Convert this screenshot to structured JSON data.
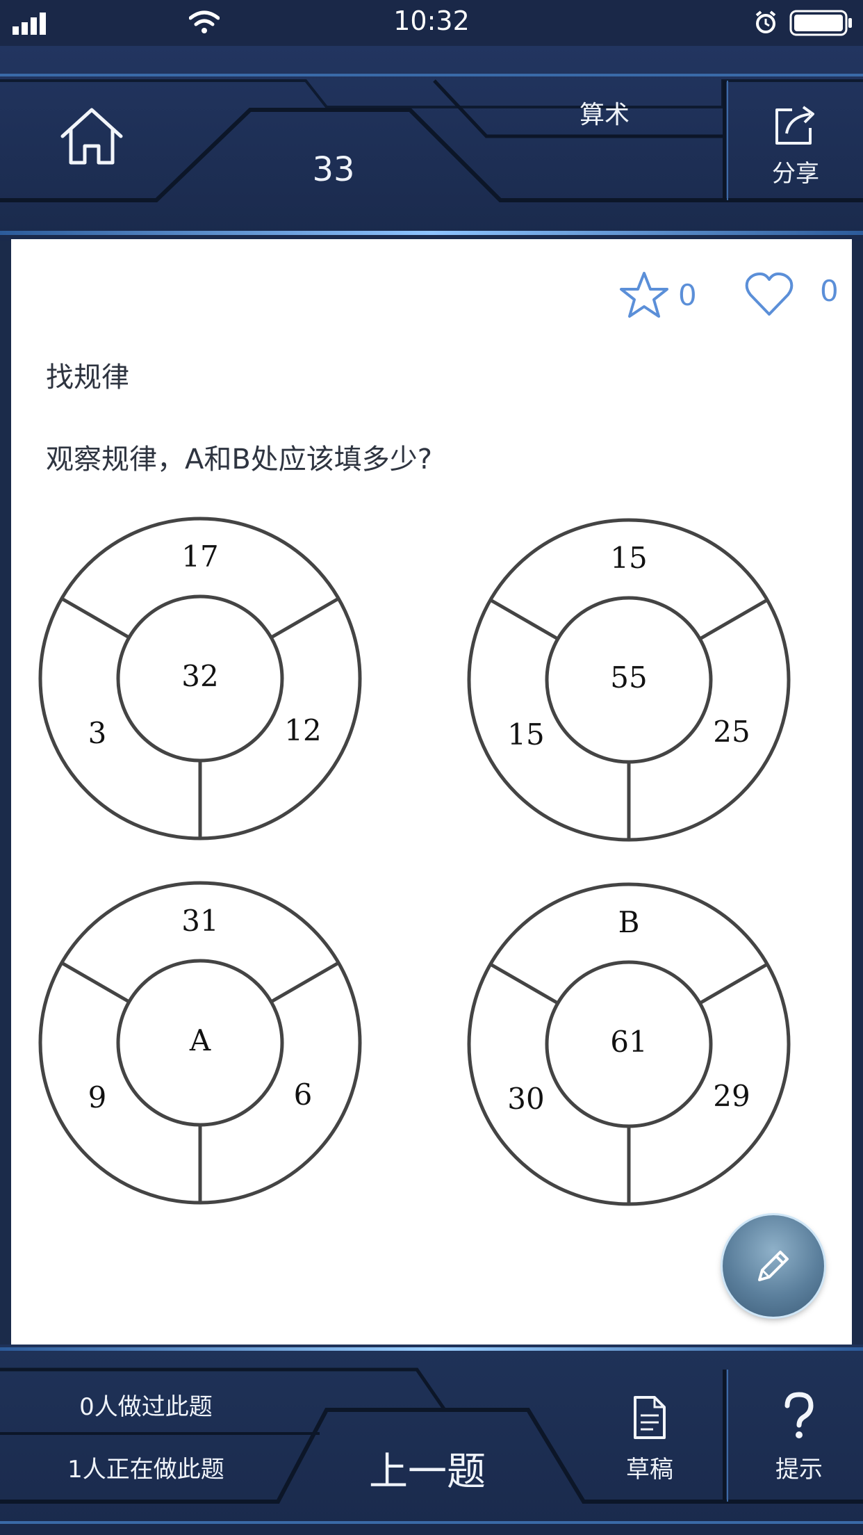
{
  "status_bar": {
    "time": "10:32",
    "icons": [
      "signal-icon",
      "wifi-icon",
      "alarm-icon",
      "battery-icon"
    ]
  },
  "header": {
    "home_icon": "home-icon",
    "question_number": "33",
    "category": "算术",
    "share_label": "分享",
    "share_icon": "share-icon"
  },
  "question": {
    "favorite_count": "0",
    "like_count": "0",
    "title": "找规律",
    "prompt": "观察规律，A和B处应该填多少?",
    "rings": [
      {
        "center": "32",
        "top": "17",
        "left": "3",
        "right": "12"
      },
      {
        "center": "55",
        "top": "15",
        "left": "15",
        "right": "25"
      },
      {
        "center": "A",
        "top": "31",
        "left": "9",
        "right": "6"
      },
      {
        "center": "61",
        "top": "B",
        "left": "30",
        "right": "29"
      }
    ]
  },
  "footer": {
    "done_count_text": "0人做过此题",
    "doing_count_text": "1人正在做此题",
    "prev_label": "上一题",
    "draft_label": "草稿",
    "hint_label": "提示"
  },
  "colors": {
    "background": "#1b2b4a",
    "panel": "#24375c",
    "glow": "#4f8fd6",
    "accent_icon": "#5b8fd8",
    "card": "#ffffff"
  }
}
